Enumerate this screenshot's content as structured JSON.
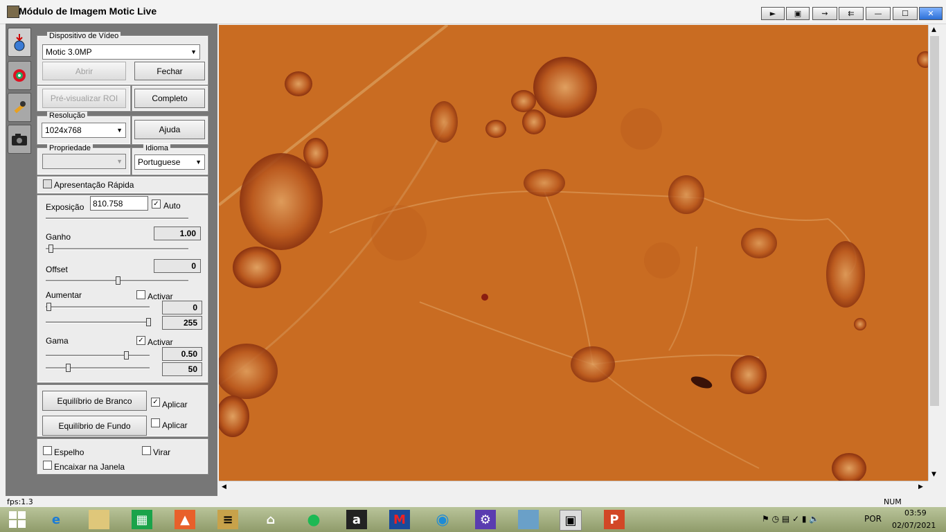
{
  "window": {
    "title": "Módulo de Imagem Motic Live",
    "buttons": [
      "►",
      "▣",
      "⇝",
      "⇇",
      "—",
      "☐",
      "✕"
    ]
  },
  "video_device": {
    "group_label": "Dispositivo de Vídeo",
    "selected": "Motic 3.0MP",
    "open_label": "Abrir",
    "close_label": "Fechar",
    "preview_roi_label": "Pré-visualizar ROI",
    "full_label": "Completo"
  },
  "resolution": {
    "group_label": "Resolução",
    "selected": "1024x768",
    "help_label": "Ajuda"
  },
  "property": {
    "group_label": "Propriedade",
    "selected": ""
  },
  "language": {
    "group_label": "Idioma",
    "selected": "Portuguese"
  },
  "fast_preview": {
    "label": "Apresentação Rápida",
    "checked": false
  },
  "exposure": {
    "label": "Exposição",
    "value": "810.758",
    "auto_label": "Auto",
    "auto_checked": true
  },
  "gain": {
    "label": "Ganho",
    "value": "1.00",
    "level": 0.02
  },
  "offset": {
    "label": "Offset",
    "value": "0",
    "level": 0.5
  },
  "enhance": {
    "label": "Aumentar",
    "activate_label": "Activar",
    "checked": false,
    "low": "0",
    "high": "255"
  },
  "gamma": {
    "label": "Gama",
    "activate_label": "Activar",
    "checked": true,
    "value1": "0.50",
    "value2": "50"
  },
  "white_balance": {
    "label": "Equilíbrio de Branco",
    "apply_label": "Aplicar",
    "checked": true
  },
  "background_balance": {
    "label": "Equilíbrio de Fundo",
    "apply_label": "Aplicar",
    "checked": false
  },
  "options": {
    "mirror_label": "Espelho",
    "flip_label": "Virar",
    "fit_label": "Encaixar na Janela"
  },
  "status": {
    "fps": "fps:1.3",
    "num": "NUM"
  },
  "taskbar": {
    "lang": "POR",
    "time": "03:59",
    "date": "02/07/2021",
    "colors": {
      "image_bg": "#c86a1e",
      "cell": "#a0471a"
    }
  }
}
